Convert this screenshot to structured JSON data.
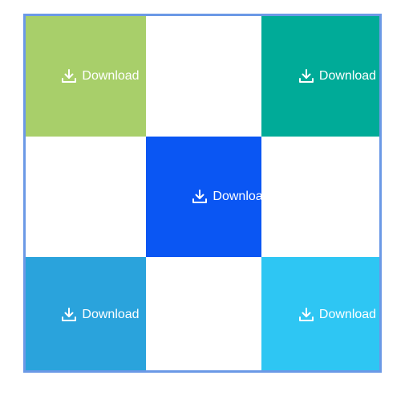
{
  "tiles": [
    {
      "label": "Download",
      "color": "#a8cf6a",
      "icon": "download-icon"
    },
    {
      "label": "",
      "color": "#ffffff",
      "icon": ""
    },
    {
      "label": "Download",
      "color": "#00ab98",
      "icon": "download-icon"
    },
    {
      "label": "",
      "color": "#ffffff",
      "icon": ""
    },
    {
      "label": "Download",
      "color": "#0a56f3",
      "icon": "download-icon"
    },
    {
      "label": "",
      "color": "#ffffff",
      "icon": ""
    },
    {
      "label": "Download",
      "color": "#2aa3dc",
      "icon": "download-icon"
    },
    {
      "label": "",
      "color": "#ffffff",
      "icon": ""
    },
    {
      "label": "Download",
      "color": "#2ec6f3",
      "icon": "download-icon"
    }
  ],
  "border_color": "#6b99e6"
}
